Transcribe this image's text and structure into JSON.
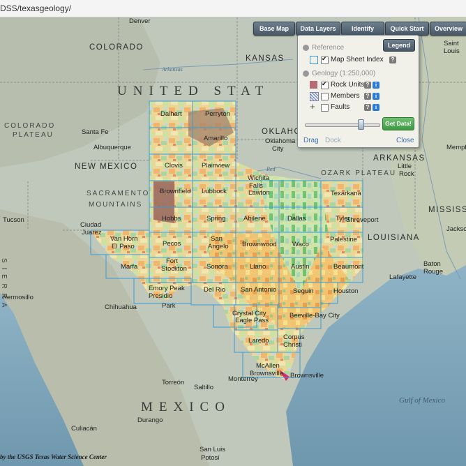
{
  "browser": {
    "url": "DSS/texasgeology/"
  },
  "toolbar": {
    "buttons": [
      "Base Map",
      "Data Layers",
      "Identify",
      "Quick Start",
      "Overview"
    ]
  },
  "panel": {
    "legend_label": "Legend",
    "reference_header": "Reference",
    "map_sheet_index": "Map Sheet Index",
    "geology_header": "Geology (1:250,000)",
    "rock_units": "Rock Units",
    "members": "Members",
    "faults": "Faults",
    "help_glyph": "?",
    "info_glyph": "i",
    "get_data": "Get Data!",
    "drag": "Drag",
    "dock": "Dock",
    "close": "Close",
    "opacity": 0.75
  },
  "map": {
    "country_labels": {
      "usa": "UNITED STAT",
      "mexico": "MEXICO"
    },
    "states": {
      "colorado": "COLORADO",
      "kansas": "KANSAS",
      "oklahoma": "OKLAHOMA",
      "new_mexico": "NEW MEXICO",
      "arkansas": "ARKANSAS",
      "louisiana": "LOUISIANA",
      "mississippi": "MISSISSIPPI"
    },
    "physical": {
      "colorado_plateau_1": "COLORADO",
      "colorado_plateau_2": "PLATEAU",
      "sacramento_1": "SACRAMENTO",
      "sacramento_2": "MOUNTAINS",
      "ozark": "OZARK PLATEAU",
      "sierra": "S I E R R A"
    },
    "cities": {
      "denver": "Denver",
      "santa_fe": "Santa Fe",
      "albuquerque": "Albuquerque",
      "tucson": "Tucson",
      "ciudad_juarez_1": "Ciudad",
      "ciudad_juarez_2": "Juarez",
      "hermosillo": "Hermosillo",
      "chihuahua": "Chihuahua",
      "monterrey": "Monterrey",
      "torreon": "Torreón",
      "saltillo": "Saltillo",
      "culiacan": "Culiacán",
      "durango": "Durango",
      "san_luis_1": "San Luis",
      "san_luis_2": "Potosí",
      "oklahoma_city_1": "Oklahoma",
      "oklahoma_city_2": "City",
      "little_rock_1": "Little",
      "little_rock_2": "Rock",
      "memphis": "Memphis",
      "jackson": "Jackson",
      "baton_rouge_1": "Baton",
      "baton_rouge_2": "Rouge",
      "lafayette": "Lafayette",
      "saint_louis_1": "Saint",
      "saint_louis_2": "Louis",
      "shreveport": "Shreveport"
    },
    "sheets": {
      "dalhart": "Dalhart",
      "perryton": "Perryton",
      "amarillo": "Amarillo",
      "plainview": "Plainview",
      "clovis": "Clovis",
      "brownfield": "Brownfield",
      "lubbock": "Lubbock",
      "wichita_falls_1": "Wichita",
      "wichita_falls_2": "Falls",
      "lawton": "Lawton",
      "texarkana": "Texarkana",
      "tyler": "Tyler",
      "hobbs": "Hobbs",
      "spring": "Spring",
      "abilene": "Abilene",
      "dallas": "Dallas",
      "van_horn_1": "Van Horn",
      "van_horn_2": "El Paso",
      "pecos": "Pecos",
      "san_angelo_1": "San",
      "san_angelo_2": "Angelo",
      "brownwood": "Brownwood",
      "waco": "Waco",
      "palestine": "Palestine",
      "marfa": "Marfa",
      "fort_stockton_1": "Fort",
      "fort_stockton_2": "Stockton",
      "sonora": "Sonora",
      "llano": "Llano",
      "austin": "Austin",
      "beaumont": "Beaumont",
      "emory_peak_1": "Emory Peak",
      "emory_peak_2": "Presidio",
      "park": "Park",
      "del_rio": "Del Rio",
      "san_antonio": "San Antonio",
      "seguin": "Seguin",
      "houston": "Houston",
      "crystal_1": "Crystal City",
      "crystal_2": "Eagle Pass",
      "beeville": "Beeville-Bay City",
      "laredo": "Laredo",
      "corpus_1": "Corpus",
      "corpus_2": "Christi",
      "mcallen_1": "McAllen",
      "mcallen_2": "Brownsville",
      "brownsville": "Brownsville"
    },
    "water": {
      "gulf": "Gulf of Mexico",
      "red_river": "Red",
      "arkansas_river": "Arkansas"
    },
    "credit": "by the USGS Texas Water Science Center"
  }
}
